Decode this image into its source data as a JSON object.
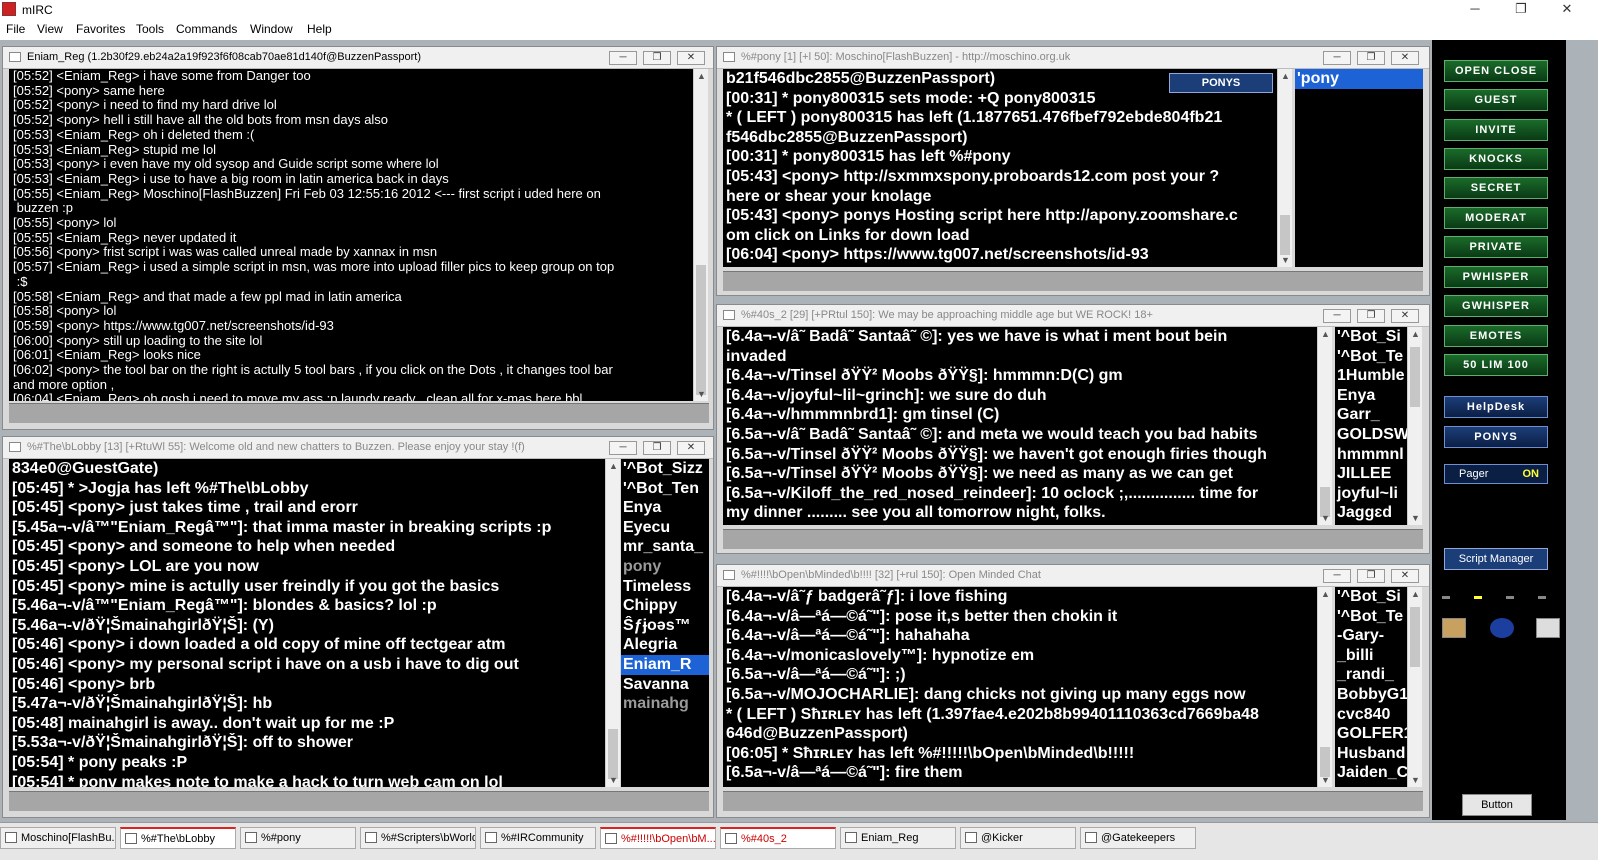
{
  "app": {
    "title": "mIRC",
    "controls": [
      "─",
      "❐",
      "✕"
    ]
  },
  "menu": [
    "File",
    "View",
    "Favorites",
    "Tools",
    "Commands",
    "Window",
    "Help"
  ],
  "windows": {
    "query": {
      "title": "Eniam_Reg  (1.2b30f29.eb24a2a19f923f6f08cab70ae81d140f@BuzzenPassport)",
      "lines": [
        "[05:52] <Eniam_Reg> i have some from Danger too",
        "[05:52] <pony> same here",
        "[05:52] <pony> i need to find my hard drive lol",
        "[05:52] <pony> hell i still have all the old bots from msn days also",
        "[05:53] <Eniam_Reg> oh i deleted them :(",
        "[05:53] <Eniam_Reg> stupid me lol",
        "[05:53] <pony> i even have my old sysop and Guide script some where lol",
        "[05:53] <Eniam_Reg> i use to have a big room in latin america back in days",
        "[05:55] <Eniam_Reg> Moschino[FlashBuzzen] Fri Feb 03 12:55:16 2012 <--- first script i uded here on",
        " buzzen :p",
        "[05:55] <pony> lol",
        "[05:55] <Eniam_Reg> never updated it",
        "[05:56] <pony> frist script i was was called unreal made by xannax in msn",
        "[05:57] <Eniam_Reg> i used a simple script in msn, was more into upload filler pics to keep group on top",
        " :$",
        "[05:58] <Eniam_Reg> and that made a few ppl mad in latin america",
        "[05:58] <pony> lol",
        "[05:59] <pony> https://www.tg007.net/screenshots/id-93",
        "[06:00] <pony> still up loading to the site lol",
        "[06:01] <Eniam_Reg> looks nice",
        "[06:02] <pony> the tool bar on the right is actully 5 tool bars , if you click on the Dots , it changes tool bar",
        "and more option ,",
        "[06:04] <Eniam_Reg> oh gosh i need to move my ass :p laundy ready , clean all for x-mas here bbl"
      ]
    },
    "pony": {
      "title": "%#pony [1] [+l 50]: Moschino[FlashBuzzen] - http://moschino.org.uk",
      "badge": "PONYS",
      "lines": [
        {
          "t": "b21f546dbc2855@BuzzenPassport)",
          "c": "c-teal"
        },
        {
          "t": "[00:31] * pony800315 sets mode: +Q pony800315",
          "c": "c-teal"
        },
        {
          "t": "* ( LEFT ) pony800315 has left (1.1877651.476fbef792ebde804fb21",
          "c": "c-teal"
        },
        {
          "t": "f546dbc2855@BuzzenPassport)",
          "c": "c-teal"
        },
        {
          "t": "[00:31] * pony800315 has left %#pony",
          "c": "c-g"
        },
        {
          "t": "[05:43] <pony> http://sxmmxspony.proboards12.com post your ?",
          "c": "c-w"
        },
        {
          "t": "here or shear your knolage",
          "c": "c-w"
        },
        {
          "t": "[05:43] <pony> ponys Hosting script here http://apony.zoomshare.c",
          "c": "c-w"
        },
        {
          "t": "om click on Links for down load",
          "c": "c-w"
        },
        {
          "t": "[06:04] <pony> https://www.tg007.net/screenshots/id-93",
          "c": "c-w"
        }
      ],
      "nicks": [
        "'pony"
      ]
    },
    "lobby": {
      "title": "%#The\\bLobby [13] [+RtuWl 55]: Welcome old and new chatters to Buzzen. Please enjoy your stay !(f)",
      "lines": [
        {
          "t": "834e0@GuestGate)",
          "c": "c-teal"
        },
        {
          "t": "[05:45] * >Jogja has left %#The\\bLobby",
          "c": "c-g"
        },
        {
          "t": "[05:45] <pony> just takes time , trail and erorr",
          "c": "c-w"
        },
        {
          "t": "[5.45a¬-v/â™\"Eniam_Regâ™\"]: that imma master in breaking scripts :p",
          "c": "c-w"
        },
        {
          "t": "[05:45] <pony> and someone to help when needed",
          "c": "c-w"
        },
        {
          "t": "[05:45] <pony> LOL are you now",
          "c": "c-w"
        },
        {
          "t": "[05:45] <pony> mine is actully user freindly if you got the basics",
          "c": "c-w"
        },
        {
          "t": "[5.46a¬-v/â™\"Eniam_Regâ™\"]: blondes & basics? lol :p",
          "c": "c-w"
        },
        {
          "t": "[5.46a¬-v/ðŸ¦ŠmainahgirlðŸ¦Š]: (Y)",
          "c": "c-w"
        },
        {
          "t": "[05:46] <pony> i down loaded a old copy of mine off tectgear atm",
          "c": "c-w"
        },
        {
          "t": "[05:46] <pony> my personal script i have on a usb i have to dig out",
          "c": "c-w"
        },
        {
          "t": "[05:46] <pony> brb",
          "c": "c-w"
        },
        {
          "t": "[5.47a¬-v/ðŸ¦ŠmainahgirlðŸ¦Š]: hb",
          "c": "c-w"
        },
        {
          "t": "[05:48] mainahgirl is away.. don't wait up for me :P",
          "c": "c-g"
        },
        {
          "t": "[5.53a¬-v/ðŸ¦ŠmainahgirlðŸ¦Š]: off to shower",
          "c": "c-w"
        },
        {
          "t": "[05:54] * pony peaks :P",
          "c": "c-m"
        },
        {
          "t": "[05:54] * pony makes note to make a hack to turn web cam on lol",
          "c": "c-m"
        }
      ],
      "nicks": [
        "'^Bot_Sizz",
        "'^Bot_Ten",
        "Enya",
        "Eyecu",
        "mr_santa_",
        "pony",
        "Timeless",
        "Chippy",
        "Ŝƒɉoəs™",
        "Alegria",
        "Eniam_R",
        "Savanna",
        "mainahg"
      ]
    },
    "fourties": {
      "title": "%#40s_2 [29] [+PRtul 150]: We may be approaching middle age but WE ROCK! 18+",
      "lines": [
        {
          "t": "[6.4a¬-v/â˜ Badâ˜ Santaâ˜ ©]: yes we have is what i ment bout bein",
          "c": "c-w"
        },
        {
          "t": "invaded",
          "c": "c-w"
        },
        {
          "t": "[6.4a¬-v/Tinsel ðŸŸ² Moobs ðŸŸ§]: hmmmn:D(C) gm",
          "c": "c-w"
        },
        {
          "t": "[6.4a¬-v/joyful~lil~grinch]: we sure do duh",
          "c": "c-w"
        },
        {
          "t": "[6.4a¬-v/hmmmnbrd1]: gm tinsel (C)",
          "c": "c-w"
        },
        {
          "t": "[6.5a¬-v/â˜ Badâ˜ Santaâ˜ ©]: and meta we would teach you bad habits",
          "c": "c-w"
        },
        {
          "t": "[6.5a¬-v/Tinsel ðŸŸ² Moobs ðŸŸ§]: we haven't got enough firies though",
          "c": "c-w"
        },
        {
          "t": "[6.5a¬-v/Tinsel ðŸŸ² Moobs ðŸŸ§]: we need as many as we can get",
          "c": "c-w"
        },
        {
          "t": "[6.5a¬-v/Kiloff_the_red_nosed_reindeer]: 10 oclock ;,............... time for",
          "c": "c-w"
        },
        {
          "t": "my dinner ......... see you all tomorrow night, folks.",
          "c": "c-w"
        }
      ],
      "nicks": [
        "'^Bot_Si",
        "'^Bot_Te",
        "1Humble",
        "Enya",
        "Garr_",
        "GOLDSW",
        "hmmmnl",
        "JILLEE",
        "joyful~li",
        "Jaggɛd"
      ]
    },
    "openminded": {
      "title": "%#!!!!\\bOpen\\bMinded\\b!!!! [32] [+rul 150]: Open Minded Chat",
      "lines": [
        {
          "t": "[6.4a¬-v/â˜ƒ badgerâ˜ƒ]: i love fishing",
          "c": "c-w"
        },
        {
          "t": "[6.4a¬-v/â—ªá—©á˜\"]: pose it,s better then chokin it",
          "c": "c-w"
        },
        {
          "t": "[6.4a¬-v/â—ªá—©á˜\"]: hahahaha",
          "c": "c-w"
        },
        {
          "t": "[6.4a¬-v/monicaslovely™]: hypnotize em",
          "c": "c-w"
        },
        {
          "t": "[6.5a¬-v/â—ªá—©á˜\"]: ;)",
          "c": "c-w"
        },
        {
          "t": "[6.5a¬-v/MOJOCHARLIE]: dang chicks not giving up many eggs now",
          "c": "c-w"
        },
        {
          "t": "* ( LEFT ) Sħɪʀʟᴇʏ has left (1.397fae4.e202b8b99401110363cd7669ba48",
          "c": "c-teal"
        },
        {
          "t": "646d@BuzzenPassport)",
          "c": "c-teal"
        },
        {
          "t": "[06:05] * Sħɪʀʟᴇʏ has left %#!!!!!\\bOpen\\bMinded\\b!!!!!",
          "c": "c-g"
        },
        {
          "t": "[6.5a¬-v/â—ªá—©á˜\"]: fire them",
          "c": "c-w"
        }
      ],
      "nicks": [
        "'^Bot_Si",
        "'^Bot_Te",
        "-Gary-",
        "_billi",
        "_randi_",
        "BobbyG1",
        "cvc840",
        "GOLFER1",
        "Husband",
        "Jaiden_C"
      ]
    }
  },
  "toolbar": {
    "buttons": [
      "OPEN CLOSE",
      "GUEST",
      "INVITE",
      "KNOCKS",
      "SECRET",
      "MODERAT",
      "PRIVATE",
      "PWHISPER",
      "GWHISPER",
      "EMOTES",
      "50 LIM 100"
    ],
    "helpdesk": "HelpDesk",
    "ponys": "PONYS",
    "pager_label": "Pager",
    "pager_state": "ON",
    "script_manager": "Script Manager",
    "button": "Button"
  },
  "taskbar": [
    "Moschino[FlashBu...",
    "%#The\\bLobby",
    "%#pony",
    "%#Scripters\\bWorld",
    "%#IRCommunity",
    "%#!!!!!\\bOpen\\bM...",
    "%#40s_2",
    "Eniam_Reg",
    "@Kicker",
    "@Gatekeepers"
  ]
}
